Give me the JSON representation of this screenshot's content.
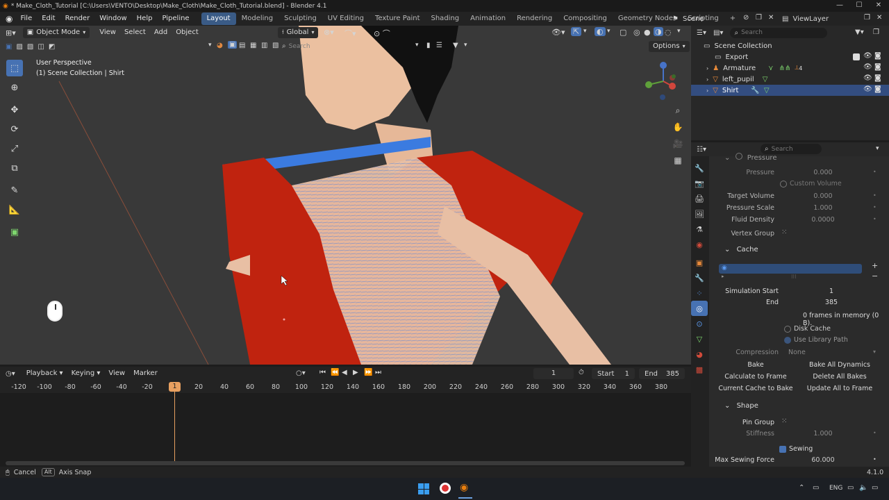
{
  "titlebar": {
    "title": "* Make_Cloth_Tutorial [C:\\Users\\VENTO\\Desktop\\Make_Cloth\\Make_Cloth_Tutorial.blend] - Blender 4.1"
  },
  "menubar": {
    "menus": [
      "File",
      "Edit",
      "Render",
      "Window",
      "Help",
      "Pipeline"
    ],
    "workspaces": [
      "Layout",
      "Modeling",
      "Sculpting",
      "UV Editing",
      "Texture Paint",
      "Shading",
      "Animation",
      "Rendering",
      "Compositing",
      "Geometry Nodes",
      "Scripting"
    ],
    "active_workspace": "Layout",
    "add_tab": "+",
    "scene": "Scene",
    "view_layer": "ViewLayer"
  },
  "viewport": {
    "mode": "Object Mode",
    "menus": [
      "View",
      "Select",
      "Add",
      "Object"
    ],
    "orientation": "Global",
    "search_placeholder": "Search",
    "options": "Options",
    "overlay_title": "User Perspective",
    "overlay_sub": "(1) Scene Collection | Shirt"
  },
  "outliner": {
    "search_placeholder": "Search",
    "root": "Scene Collection",
    "items": [
      "Export",
      "Armature",
      "left_pupil",
      "Shirt"
    ],
    "selected": "Shirt",
    "armature_count": "4"
  },
  "properties": {
    "search_placeholder": "Search",
    "pressure_header": "Pressure",
    "pressure": {
      "label": "Pressure",
      "value": "0.000"
    },
    "custom_volume": "Custom Volume",
    "target_volume": {
      "label": "Target Volume",
      "value": "0.000"
    },
    "pressure_scale": {
      "label": "Pressure Scale",
      "value": "1.000"
    },
    "fluid_density": {
      "label": "Fluid Density",
      "value": "0.0000"
    },
    "vertex_group": {
      "label": "Vertex Group"
    },
    "cache_header": "Cache",
    "sim_start": {
      "label": "Simulation Start",
      "value": "1"
    },
    "sim_end": {
      "label": "End",
      "value": "385"
    },
    "frames_info": "0 frames in memory (0 B).",
    "disk_cache": "Disk Cache",
    "use_library_path": "Use Library Path",
    "compression": {
      "label": "Compression",
      "value": "None"
    },
    "bake_buttons": [
      "Bake",
      "Bake All Dynamics",
      "Calculate to Frame",
      "Delete All Bakes",
      "Current Cache to Bake",
      "Update All to Frame"
    ],
    "shape_header": "Shape",
    "pin_group": {
      "label": "Pin Group"
    },
    "stiffness": {
      "label": "Stiffness",
      "value": "1.000"
    },
    "sewing": "Sewing",
    "max_sewing": {
      "label": "Max Sewing Force",
      "value": "60.000"
    }
  },
  "timeline": {
    "menus": [
      "Playback",
      "Keying",
      "View",
      "Marker"
    ],
    "current_frame": "1",
    "start_label": "Start",
    "start": "1",
    "end_label": "End",
    "end": "385",
    "ticks": [
      "-120",
      "-100",
      "-80",
      "-60",
      "-40",
      "-20",
      "1",
      "20",
      "40",
      "60",
      "80",
      "100",
      "120",
      "140",
      "160",
      "180",
      "200",
      "220",
      "240",
      "260",
      "280",
      "300",
      "320",
      "340",
      "360",
      "380"
    ]
  },
  "status": {
    "cancel": "Cancel",
    "alt_key": "Alt",
    "axis_snap": "Axis Snap",
    "version": "4.1.0"
  },
  "taskbar": {
    "lang": "ENG"
  },
  "colors": {
    "accent": "#4772b3",
    "selected_row": "#334d80",
    "cloth_red": "#c0230f",
    "playhead": "#e8a060",
    "active_tab": "#3a5b86"
  }
}
